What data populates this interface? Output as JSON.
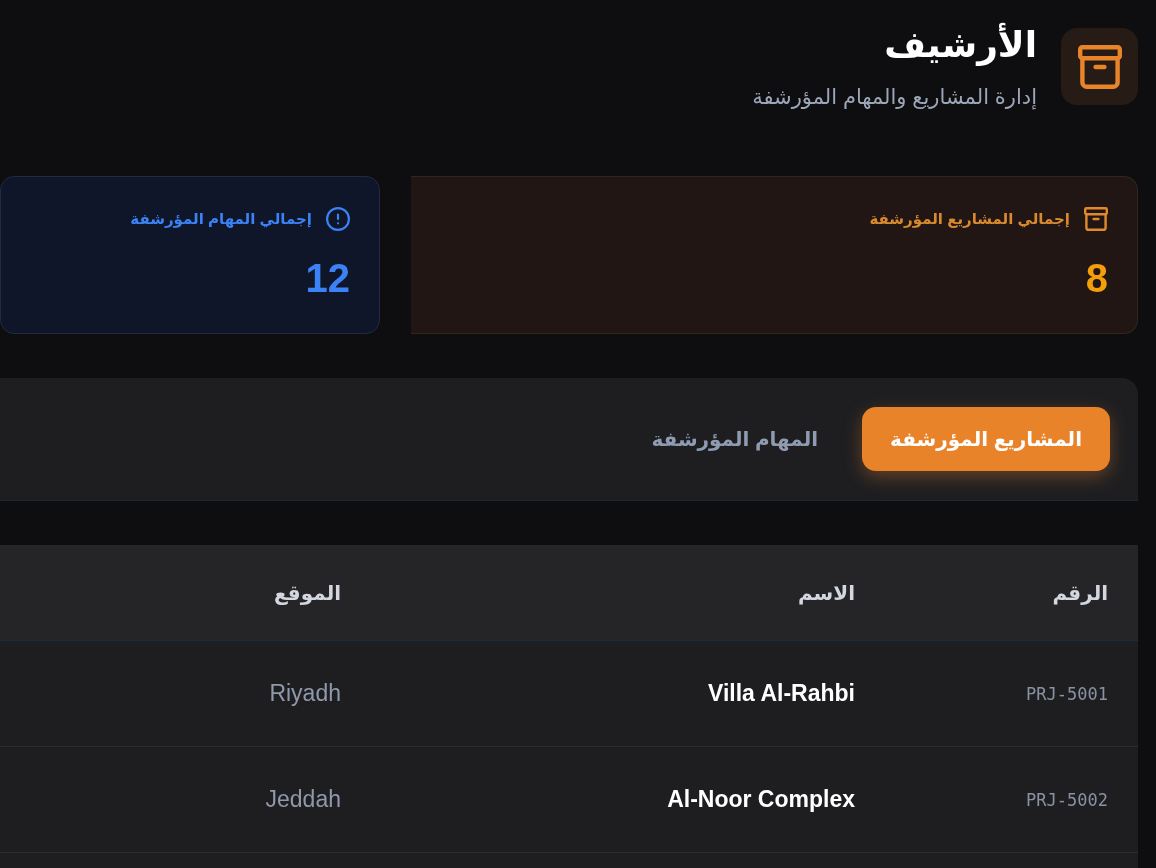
{
  "header": {
    "title": "الأرشيف",
    "subtitle": "إدارة المشاريع والمهام المؤرشفة"
  },
  "stats": [
    {
      "kind": "projects",
      "label": "إجمالي المشاريع المؤرشفة",
      "value": "8"
    },
    {
      "kind": "tasks",
      "label": "إجمالي المهام المؤرشفة",
      "value": "12"
    }
  ],
  "tabs": [
    {
      "label": "المشاريع المؤرشفة",
      "selected": true
    },
    {
      "label": "المهام المؤرشفة",
      "selected": false
    }
  ],
  "table": {
    "columns": [
      "الرقم",
      "الاسم",
      "الموقع"
    ],
    "rows": [
      {
        "id": "PRJ-5001",
        "name": "Villa Al-Rahbi",
        "location": "Riyadh"
      },
      {
        "id": "PRJ-5002",
        "name": "Al-Noor Complex",
        "location": "Jeddah"
      }
    ]
  }
}
